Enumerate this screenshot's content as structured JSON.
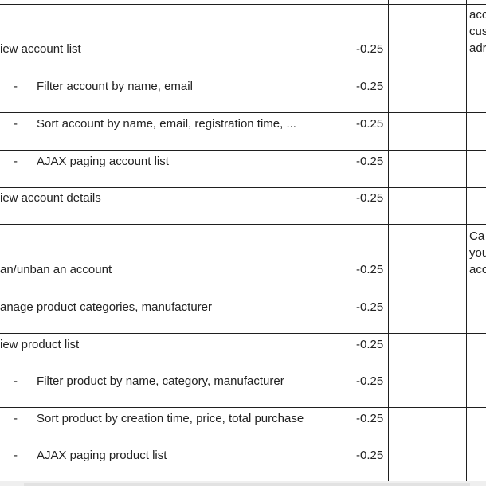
{
  "rows": [
    {
      "text": "iew account list",
      "score": "-0.25",
      "note": "acc\ncus\nadr"
    },
    {
      "text": "Filter account by name, email",
      "score": "-0.25",
      "dash": "-"
    },
    {
      "text": "Sort account by name, email, registration time, ...",
      "score": "-0.25",
      "dash": "-"
    },
    {
      "text": "AJAX paging account list",
      "score": "-0.25",
      "dash": "-"
    },
    {
      "text": "iew account details",
      "score": "-0.25"
    },
    {
      "text": "an/unban an account",
      "score": "-0.25",
      "note": "Ca\nyou\nacc"
    },
    {
      "text": "anage product categories, manufacturer",
      "score": "-0.25"
    },
    {
      "text": "iew product list",
      "score": "-0.25"
    },
    {
      "text": "Filter product by name, category, manufacturer",
      "score": "-0.25",
      "dash": "-"
    },
    {
      "text": "Sort product by creation time, price, total purchase",
      "score": "-0.25",
      "dash": "-"
    },
    {
      "text": "AJAX paging product list",
      "score": "-0.25",
      "dash": "-"
    }
  ]
}
